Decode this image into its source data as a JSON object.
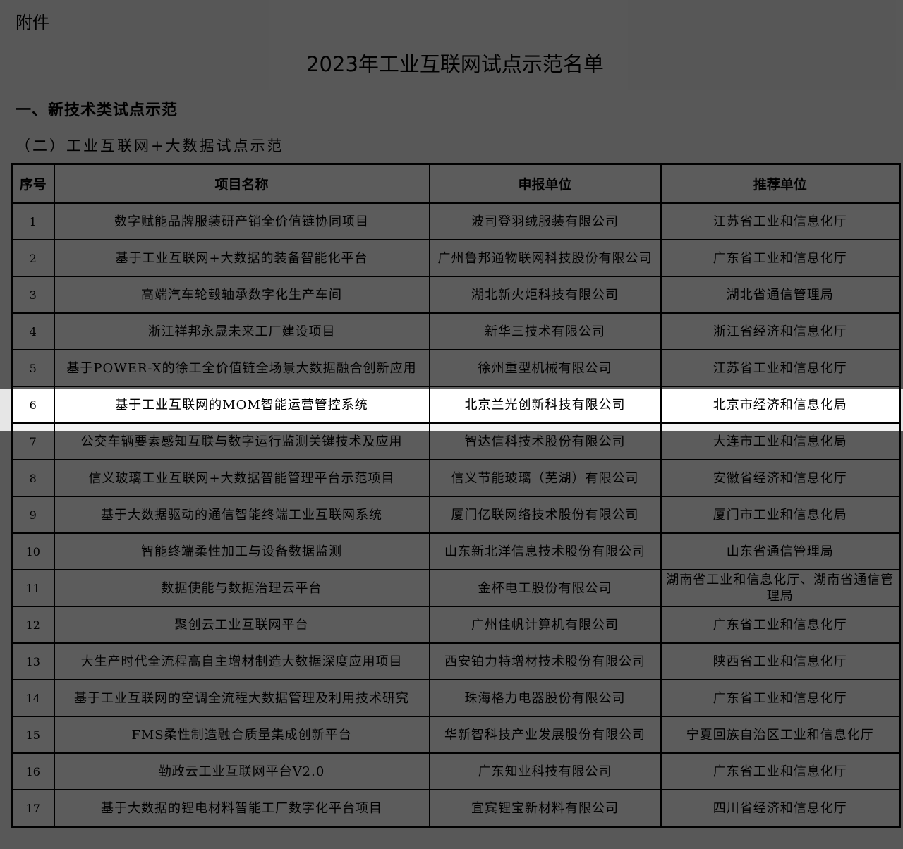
{
  "attachment_label": "附件",
  "title": "2023年工业互联网试点示范名单",
  "section_heading": "一、新技术类试点示范",
  "subsection_heading": "（二）工业互联网+大数据试点示范",
  "table": {
    "headers": [
      "序号",
      "项目名称",
      "申报单位",
      "推荐单位"
    ],
    "rows": [
      {
        "no": "1",
        "project": "数字赋能品牌服装研产销全价值链协同项目",
        "applicant": "波司登羽绒服装有限公司",
        "recommender": "江苏省工业和信息化厅"
      },
      {
        "no": "2",
        "project": "基于工业互联网+大数据的装备智能化平台",
        "applicant": "广州鲁邦通物联网科技股份有限公司",
        "recommender": "广东省工业和信息化厅"
      },
      {
        "no": "3",
        "project": "高端汽车轮毂轴承数字化生产车间",
        "applicant": "湖北新火炬科技有限公司",
        "recommender": "湖北省通信管理局"
      },
      {
        "no": "4",
        "project": "浙江祥邦永晟未来工厂建设项目",
        "applicant": "新华三技术有限公司",
        "recommender": "浙江省经济和信息化厅"
      },
      {
        "no": "5",
        "project": "基于POWER-X的徐工全价值链全场景大数据融合创新应用",
        "applicant": "徐州重型机械有限公司",
        "recommender": "江苏省工业和信息化厅"
      },
      {
        "no": "6",
        "project": "基于工业互联网的MOM智能运营管控系统",
        "applicant": "北京兰光创新科技有限公司",
        "recommender": "北京市经济和信息化局"
      },
      {
        "no": "7",
        "project": "公交车辆要素感知互联与数字运行监测关键技术及应用",
        "applicant": "智达信科技术股份有限公司",
        "recommender": "大连市工业和信息化局"
      },
      {
        "no": "8",
        "project": "信义玻璃工业互联网+大数据智能管理平台示范项目",
        "applicant": "信义节能玻璃（芜湖）有限公司",
        "recommender": "安徽省经济和信息化厅"
      },
      {
        "no": "9",
        "project": "基于大数据驱动的通信智能终端工业互联网系统",
        "applicant": "厦门亿联网络技术股份有限公司",
        "recommender": "厦门市工业和信息化局"
      },
      {
        "no": "10",
        "project": "智能终端柔性加工与设备数据监测",
        "applicant": "山东新北洋信息技术股份有限公司",
        "recommender": "山东省通信管理局"
      },
      {
        "no": "11",
        "project": "数据使能与数据治理云平台",
        "applicant": "金杯电工股份有限公司",
        "recommender": "湖南省工业和信息化厅、湖南省通信管理局"
      },
      {
        "no": "12",
        "project": "聚创云工业互联网平台",
        "applicant": "广州佳帆计算机有限公司",
        "recommender": "广东省工业和信息化厅"
      },
      {
        "no": "13",
        "project": "大生产时代全流程高自主增材制造大数据深度应用项目",
        "applicant": "西安铂力特增材技术股份有限公司",
        "recommender": "陕西省工业和信息化厅"
      },
      {
        "no": "14",
        "project": "基于工业互联网的空调全流程大数据管理及利用技术研究",
        "applicant": "珠海格力电器股份有限公司",
        "recommender": "广东省工业和信息化厅"
      },
      {
        "no": "15",
        "project": "FMS柔性制造融合质量集成创新平台",
        "applicant": "华新智科技产业发展股份有限公司",
        "recommender": "宁夏回族自治区工业和信息化厅"
      },
      {
        "no": "16",
        "project": "勤政云工业互联网平台V2.0",
        "applicant": "广东知业科技有限公司",
        "recommender": "广东省工业和信息化厅"
      },
      {
        "no": "17",
        "project": "基于大数据的锂电材料智能工厂数字化平台项目",
        "applicant": "宜宾锂宝新材料有限公司",
        "recommender": "四川省经济和信息化厅"
      }
    ]
  },
  "highlighted_row_no": "6"
}
